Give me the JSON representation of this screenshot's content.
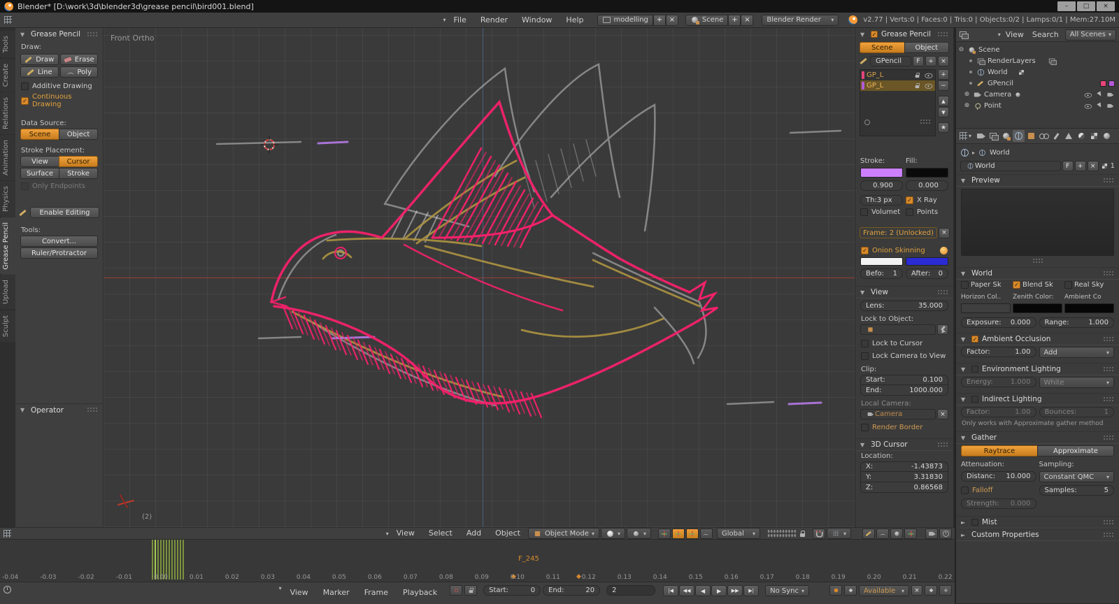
{
  "colors": {
    "accent": "#d98a2c",
    "gp_pink": "#f4216b",
    "gp_purple": "#b57ae6",
    "gp_yellow": "#b59a42",
    "layer1_color": "#e8447a",
    "layer2_color": "#b558d8",
    "stroke_swatch": "#cc80ff",
    "fill_swatch": "#0a0a0a",
    "onion_before": "#f2f2f2",
    "onion_after": "#2b2bd4",
    "horizon_color": "#3f3f3f",
    "zenith_color": "#060606",
    "ambient_color": "#060606",
    "keyframe_green": "#86a23c"
  },
  "glyphs": {
    "open": "▼",
    "closed": "►",
    "dd": "▾",
    "close": "×",
    "plus": "+",
    "minus": "−",
    "check": "✓",
    "star": "★",
    "diamond": "◆",
    "up": "▲",
    "down": "▼",
    "expand_open": "⊖",
    "expand_closed": "⊕",
    "jump_start": "|◀",
    "prev_key": "◀◀",
    "play_rev": "◀",
    "play": "▶",
    "next_key": "▶▶",
    "jump_end": "▶|"
  },
  "window": {
    "title": "Blender* [D:\\work\\3d\\blender3d\\grease pencil\\bird001.blend]",
    "minimize": "–",
    "maximize": "□",
    "close": "×"
  },
  "topbar": {
    "menus": [
      "File",
      "Render",
      "Window",
      "Help"
    ],
    "layout": "modelling",
    "scene": "Scene",
    "engine": "Blender Render",
    "stats": "v2.77 | Verts:0 | Faces:0 | Tris:0 | Objects:0/2 | Lamps:0/1 | Mem:27.10M"
  },
  "toolshelf": {
    "tabs": [
      "Tools",
      "Create",
      "Relations",
      "Animation",
      "Physics",
      "Grease Pencil",
      "Upload",
      "Sculpt"
    ],
    "panel": "Grease Pencil",
    "draw_label": "Draw:",
    "draw": "Draw",
    "erase": "Erase",
    "line": "Line",
    "poly": "Poly",
    "additive": "Additive Drawing",
    "continuous": "Continuous Drawing",
    "data_source_label": "Data Source:",
    "scene": "Scene",
    "object": "Object",
    "placement_label": "Stroke Placement:",
    "view": "View",
    "cursor": "Cursor",
    "surface": "Surface",
    "stroke": "Stroke",
    "only_endpoints": "Only Endpoints",
    "enable_editing": "Enable Editing",
    "tools_label": "Tools:",
    "convert": "Convert...",
    "ruler": "Ruler/Protractor",
    "operator": "Operator"
  },
  "viewport": {
    "view_label": "Front Ortho",
    "layer_indicator": "(2)",
    "header": {
      "menus": [
        "View",
        "Select",
        "Add",
        "Object"
      ],
      "mode": "Object Mode",
      "orientation": "Global"
    }
  },
  "npanel": {
    "gp": {
      "title": "Grease Pencil",
      "scene_tab": "Scene",
      "object_tab": "Object",
      "datablock": "GPencil",
      "fake_user": "F",
      "layers": [
        {
          "name": "GP_L"
        },
        {
          "name": "GP_L"
        }
      ],
      "stroke_label": "Stroke:",
      "fill_label": "Fill:",
      "stroke_alpha": "0.900",
      "fill_alpha": "0.000",
      "thickness": "Th:3 px",
      "xray": "X Ray",
      "volumetric": "Volumet",
      "points": "Points",
      "frame_btn": "Frame: 2 (Unlocked)",
      "onion": "Onion Skinning",
      "before_label": "Befo:",
      "before": "1",
      "after_label": "After:",
      "after": "0"
    },
    "view": {
      "title": "View",
      "lens_label": "Lens:",
      "lens": "35.000",
      "lock_obj": "Lock to Object:",
      "lock_cursor": "Lock to Cursor",
      "lock_cam": "Lock Camera to View",
      "clip": "Clip:",
      "start_label": "Start:",
      "start": "0.100",
      "end_label": "End:",
      "end": "1000.000",
      "local_cam": "Local Camera:",
      "camera": "Camera",
      "render_border": "Render Border"
    },
    "cursor": {
      "title": "3D Cursor",
      "location": "Location:",
      "x_label": "X:",
      "x": "-1.43873",
      "y_label": "Y:",
      "y": "3.31830",
      "z_label": "Z:",
      "z": "0.86568"
    }
  },
  "outliner": {
    "menus": [
      "View",
      "Search"
    ],
    "scope": "All Scenes",
    "rows": [
      {
        "label": "Scene"
      },
      {
        "label": "RenderLayers"
      },
      {
        "label": "World"
      },
      {
        "label": "GPencil"
      },
      {
        "label": "Camera"
      },
      {
        "label": "Point"
      }
    ]
  },
  "properties": {
    "context": "World",
    "datablock": {
      "name": "World",
      "fake_user": "F",
      "users": "1"
    },
    "preview_title": "Preview",
    "world": {
      "title": "World",
      "paper": "Paper Sk",
      "blend": "Blend Sk",
      "real": "Real Sky",
      "horizon": "Horizon Col..",
      "zenith": "Zenith Color:",
      "ambient": "Ambient Co",
      "exposure_label": "Exposure:",
      "exposure": "0.000",
      "range_label": "Range:",
      "range": "1.000"
    },
    "ao": {
      "title": "Ambient Occlusion",
      "factor_label": "Factor:",
      "factor": "1.00",
      "blend": "Add"
    },
    "env": {
      "title": "Environment Lighting",
      "energy_label": "Energy:",
      "energy": "1.000",
      "color": "White"
    },
    "indirect": {
      "title": "Indirect Lighting",
      "factor_label": "Factor:",
      "factor": "1.00",
      "bounces_label": "Bounces:",
      "bounces": "1",
      "note": "Only works with Approximate gather method"
    },
    "gather": {
      "title": "Gather",
      "raytrace": "Raytrace",
      "approximate": "Approximate",
      "attenuation": "Attenuation:",
      "sampling": "Sampling:",
      "distance_label": "Distanc:",
      "distance": "10.000",
      "method": "Constant QMC",
      "falloff": "Falloff",
      "samples_label": "Samples:",
      "samples": "5",
      "strength_label": "Strength:",
      "strength": "0.000"
    },
    "mist": "Mist",
    "custom": "Custom Properties"
  },
  "timeline": {
    "ruler": [
      "-0.04",
      "-0.03",
      "-0.02",
      "-0.01",
      "0.00",
      "0.01",
      "0.02",
      "0.03",
      "0.04",
      "0.05",
      "0.06",
      "0.07",
      "0.08",
      "0.09",
      "0.10",
      "0.11",
      "0.12",
      "0.13",
      "0.14",
      "0.15",
      "0.16",
      "0.17",
      "0.18",
      "0.19",
      "0.20",
      "0.21",
      "0.22"
    ],
    "marker": "F_245",
    "menus": [
      "View",
      "Marker",
      "Frame",
      "Playback"
    ],
    "start_label": "Start:",
    "start": "0",
    "end_label": "End:",
    "end": "20",
    "frame": "2",
    "sync": "No Sync",
    "keyingset": "Available"
  }
}
